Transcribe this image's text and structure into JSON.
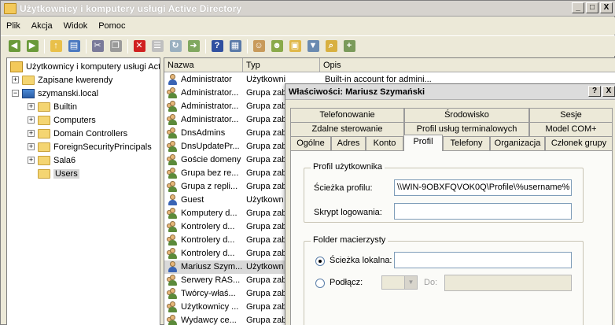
{
  "window": {
    "title": "Użytkownicy i komputery usługi Active Directory",
    "minimize": "_",
    "maximize": "□",
    "close": "X"
  },
  "menu": [
    "Plik",
    "Akcja",
    "Widok",
    "Pomoc"
  ],
  "toolbar_icons": [
    "back-icon",
    "forward-icon",
    "up-folder-icon",
    "show-hide-tree-icon",
    "cut-icon",
    "copy-icon",
    "delete-icon",
    "properties-icon",
    "refresh-icon",
    "export-list-icon",
    "help-icon",
    "console-icon",
    "new-user-icon",
    "new-group-icon",
    "new-ou-icon",
    "filter-icon",
    "find-icon",
    "add-to-group-icon"
  ],
  "tree": {
    "root": "Użytkownicy i komputery usługi Act",
    "saved_queries": "Zapisane kwerendy",
    "domain": "szymanski.local",
    "children": [
      "Builtin",
      "Computers",
      "Domain Controllers",
      "ForeignSecurityPrincipals",
      "Sala6",
      "Users"
    ]
  },
  "list": {
    "columns": [
      "Nazwa",
      "Typ",
      "Opis"
    ],
    "rows": [
      {
        "name": "Administrator",
        "type": "Użytkownik",
        "desc": "Built-in account for admini...",
        "kind": "user"
      },
      {
        "name": "Administrator...",
        "type": "Grupa zab",
        "desc": "",
        "kind": "group"
      },
      {
        "name": "Administrator...",
        "type": "Grupa zab",
        "desc": "",
        "kind": "group"
      },
      {
        "name": "Administrator...",
        "type": "Grupa zab",
        "desc": "",
        "kind": "group"
      },
      {
        "name": "DnsAdmins",
        "type": "Grupa zab",
        "desc": "",
        "kind": "group"
      },
      {
        "name": "DnsUpdatePr...",
        "type": "Grupa zab",
        "desc": "",
        "kind": "group"
      },
      {
        "name": "Goście domeny",
        "type": "Grupa zab",
        "desc": "",
        "kind": "group"
      },
      {
        "name": "Grupa bez re...",
        "type": "Grupa zab",
        "desc": "",
        "kind": "group"
      },
      {
        "name": "Grupa z repli...",
        "type": "Grupa zab",
        "desc": "",
        "kind": "group"
      },
      {
        "name": "Guest",
        "type": "Użytkown",
        "desc": "",
        "kind": "user"
      },
      {
        "name": "Komputery d...",
        "type": "Grupa zab",
        "desc": "",
        "kind": "group"
      },
      {
        "name": "Kontrolery d...",
        "type": "Grupa zab",
        "desc": "",
        "kind": "group"
      },
      {
        "name": "Kontrolery d...",
        "type": "Grupa zab",
        "desc": "",
        "kind": "group"
      },
      {
        "name": "Kontrolery d...",
        "type": "Grupa zab",
        "desc": "",
        "kind": "group"
      },
      {
        "name": "Mariusz Szym...",
        "type": "Użytkown",
        "desc": "",
        "kind": "user",
        "selected": true
      },
      {
        "name": "Serwery RAS...",
        "type": "Grupa zab",
        "desc": "",
        "kind": "group"
      },
      {
        "name": "Twórcy-właś...",
        "type": "Grupa zab",
        "desc": "",
        "kind": "group"
      },
      {
        "name": "Użytkownicy ...",
        "type": "Grupa zab",
        "desc": "",
        "kind": "group"
      },
      {
        "name": "Wydawcy ce...",
        "type": "Grupa zab",
        "desc": "",
        "kind": "group"
      }
    ]
  },
  "dialog": {
    "title": "Właściwości: Mariusz Szymański",
    "help": "?",
    "close": "X",
    "tabs_row1": [
      "Telefonowanie",
      "Środowisko",
      "Sesje"
    ],
    "tabs_row2": [
      "Zdalne sterowanie",
      "Profil usług terminalowych",
      "Model COM+"
    ],
    "tabs_row3": [
      "Ogólne",
      "Adres",
      "Konto",
      "Profil",
      "Telefony",
      "Organizacja",
      "Członek grupy"
    ],
    "active_tab": "Profil",
    "profile_group": {
      "title": "Profil użytkownika",
      "path_label": "Ścieżka profilu:",
      "path_value": "\\\\WIN-9OBXFQVOK0Q\\Profile\\%username%",
      "script_label": "Skrypt logowania:",
      "script_value": ""
    },
    "home_group": {
      "title": "Folder macierzysty",
      "local_label": "Ścieżka lokalna:",
      "local_value": "",
      "local_checked": true,
      "connect_label": "Podłącz:",
      "connect_checked": false,
      "drive_value": "",
      "to_label": "Do:",
      "to_value": ""
    }
  }
}
